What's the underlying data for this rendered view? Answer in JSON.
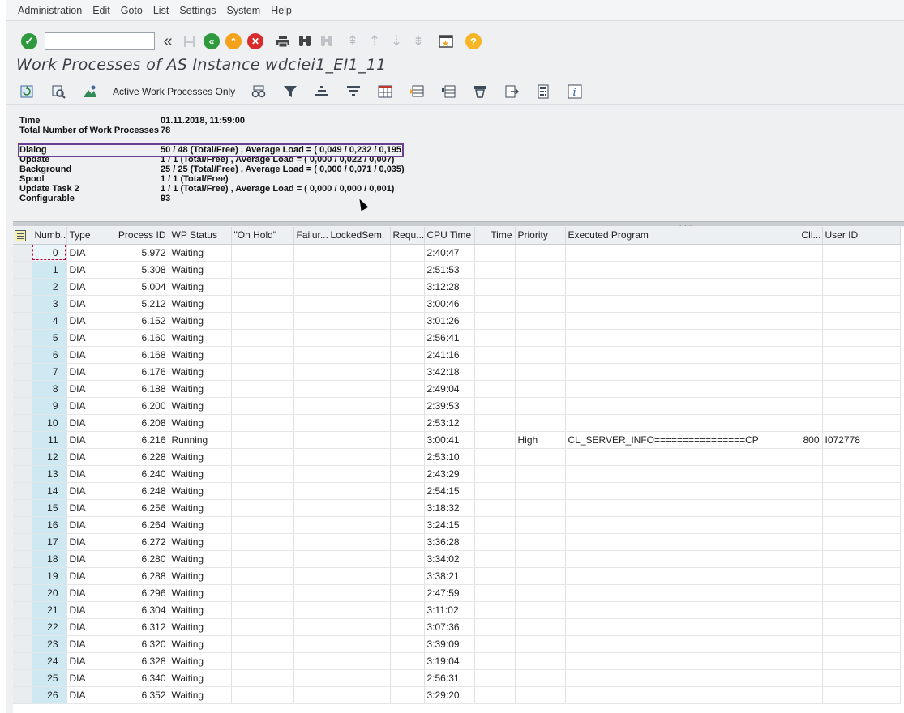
{
  "menu": [
    "Administration",
    "Edit",
    "Goto",
    "List",
    "Settings",
    "System",
    "Help"
  ],
  "toolbar": {
    "command_value": "",
    "expand_glyph": "«"
  },
  "title": "Work Processes of AS Instance wdciei1_EI1_11",
  "app_toolbar": {
    "active_only_label": "Active Work Processes Only"
  },
  "info": {
    "time_label": "Time",
    "time_value": "01.11.2018, 11:59:00",
    "total_label": "Total Number of Work Processes",
    "total_value": "78",
    "dialog_label": "Dialog",
    "dialog_value": "50 / 48 (Total/Free) , Average Load = ( 0,049 / 0,232 / 0,195",
    "update_label": "Update",
    "update_value": "1 / 1 (Total/Free) , Average Load = ( 0,000 / 0,022 / 0,007)",
    "background_label": "Background",
    "background_value": "25 / 25 (Total/Free) , Average Load = ( 0,000 / 0,071 / 0,035)",
    "spool_label": "Spool",
    "spool_value": "1 / 1 (Total/Free)",
    "update2_label": "Update Task 2",
    "update2_value": "1 / 1 (Total/Free) , Average Load = ( 0,000 / 0,000 / 0,001)",
    "config_label": "Configurable",
    "config_value": "93"
  },
  "splitter_grip": ".....",
  "table": {
    "headers": {
      "number": "Numb...",
      "type": "Type",
      "pid": "Process ID",
      "status": "WP Status",
      "onhold": "\"On Hold\"",
      "failures": "Failur...",
      "locked": "LockedSem.",
      "requests": "Requ...",
      "cpu": "CPU Time",
      "time": "Time",
      "priority": "Priority",
      "program": "Executed Program",
      "client": "Cli...",
      "user": "User ID"
    },
    "rows": [
      {
        "num": "0",
        "type": "DIA",
        "pid": "5.972",
        "status": "Waiting",
        "cpu": "2:40:47",
        "priority": "",
        "program": "",
        "client": "",
        "user": ""
      },
      {
        "num": "1",
        "type": "DIA",
        "pid": "5.308",
        "status": "Waiting",
        "cpu": "2:51:53",
        "priority": "",
        "program": "",
        "client": "",
        "user": ""
      },
      {
        "num": "2",
        "type": "DIA",
        "pid": "5.004",
        "status": "Waiting",
        "cpu": "3:12:28",
        "priority": "",
        "program": "",
        "client": "",
        "user": ""
      },
      {
        "num": "3",
        "type": "DIA",
        "pid": "5.212",
        "status": "Waiting",
        "cpu": "3:00:46",
        "priority": "",
        "program": "",
        "client": "",
        "user": ""
      },
      {
        "num": "4",
        "type": "DIA",
        "pid": "6.152",
        "status": "Waiting",
        "cpu": "3:01:26",
        "priority": "",
        "program": "",
        "client": "",
        "user": ""
      },
      {
        "num": "5",
        "type": "DIA",
        "pid": "6.160",
        "status": "Waiting",
        "cpu": "2:56:41",
        "priority": "",
        "program": "",
        "client": "",
        "user": ""
      },
      {
        "num": "6",
        "type": "DIA",
        "pid": "6.168",
        "status": "Waiting",
        "cpu": "2:41:16",
        "priority": "",
        "program": "",
        "client": "",
        "user": ""
      },
      {
        "num": "7",
        "type": "DIA",
        "pid": "6.176",
        "status": "Waiting",
        "cpu": "3:42:18",
        "priority": "",
        "program": "",
        "client": "",
        "user": ""
      },
      {
        "num": "8",
        "type": "DIA",
        "pid": "6.188",
        "status": "Waiting",
        "cpu": "2:49:04",
        "priority": "",
        "program": "",
        "client": "",
        "user": ""
      },
      {
        "num": "9",
        "type": "DIA",
        "pid": "6.200",
        "status": "Waiting",
        "cpu": "2:39:53",
        "priority": "",
        "program": "",
        "client": "",
        "user": ""
      },
      {
        "num": "10",
        "type": "DIA",
        "pid": "6.208",
        "status": "Waiting",
        "cpu": "2:53:12",
        "priority": "",
        "program": "",
        "client": "",
        "user": ""
      },
      {
        "num": "11",
        "type": "DIA",
        "pid": "6.216",
        "status": "Running",
        "cpu": "3:00:41",
        "priority": "High",
        "program": "CL_SERVER_INFO================CP",
        "client": "800",
        "user": "I072778"
      },
      {
        "num": "12",
        "type": "DIA",
        "pid": "6.228",
        "status": "Waiting",
        "cpu": "2:53:10",
        "priority": "",
        "program": "",
        "client": "",
        "user": ""
      },
      {
        "num": "13",
        "type": "DIA",
        "pid": "6.240",
        "status": "Waiting",
        "cpu": "2:43:29",
        "priority": "",
        "program": "",
        "client": "",
        "user": ""
      },
      {
        "num": "14",
        "type": "DIA",
        "pid": "6.248",
        "status": "Waiting",
        "cpu": "2:54:15",
        "priority": "",
        "program": "",
        "client": "",
        "user": ""
      },
      {
        "num": "15",
        "type": "DIA",
        "pid": "6.256",
        "status": "Waiting",
        "cpu": "3:18:32",
        "priority": "",
        "program": "",
        "client": "",
        "user": ""
      },
      {
        "num": "16",
        "type": "DIA",
        "pid": "6.264",
        "status": "Waiting",
        "cpu": "3:24:15",
        "priority": "",
        "program": "",
        "client": "",
        "user": ""
      },
      {
        "num": "17",
        "type": "DIA",
        "pid": "6.272",
        "status": "Waiting",
        "cpu": "3:36:28",
        "priority": "",
        "program": "",
        "client": "",
        "user": ""
      },
      {
        "num": "18",
        "type": "DIA",
        "pid": "6.280",
        "status": "Waiting",
        "cpu": "3:34:02",
        "priority": "",
        "program": "",
        "client": "",
        "user": ""
      },
      {
        "num": "19",
        "type": "DIA",
        "pid": "6.288",
        "status": "Waiting",
        "cpu": "3:38:21",
        "priority": "",
        "program": "",
        "client": "",
        "user": ""
      },
      {
        "num": "20",
        "type": "DIA",
        "pid": "6.296",
        "status": "Waiting",
        "cpu": "2:47:59",
        "priority": "",
        "program": "",
        "client": "",
        "user": ""
      },
      {
        "num": "21",
        "type": "DIA",
        "pid": "6.304",
        "status": "Waiting",
        "cpu": "3:11:02",
        "priority": "",
        "program": "",
        "client": "",
        "user": ""
      },
      {
        "num": "22",
        "type": "DIA",
        "pid": "6.312",
        "status": "Waiting",
        "cpu": "3:07:36",
        "priority": "",
        "program": "",
        "client": "",
        "user": ""
      },
      {
        "num": "23",
        "type": "DIA",
        "pid": "6.320",
        "status": "Waiting",
        "cpu": "3:39:09",
        "priority": "",
        "program": "",
        "client": "",
        "user": ""
      },
      {
        "num": "24",
        "type": "DIA",
        "pid": "6.328",
        "status": "Waiting",
        "cpu": "3:19:04",
        "priority": "",
        "program": "",
        "client": "",
        "user": ""
      },
      {
        "num": "25",
        "type": "DIA",
        "pid": "6.340",
        "status": "Waiting",
        "cpu": "2:56:31",
        "priority": "",
        "program": "",
        "client": "",
        "user": ""
      },
      {
        "num": "26",
        "type": "DIA",
        "pid": "6.352",
        "status": "Waiting",
        "cpu": "3:29:20",
        "priority": "",
        "program": "",
        "client": "",
        "user": ""
      }
    ]
  },
  "colors": {
    "highlight_border": "#6b3f8f",
    "number_cell": "#cfe9f3",
    "ok_green": "#2e9a3d",
    "cancel_red": "#d92b2b",
    "help_yellow": "#f5b524"
  }
}
